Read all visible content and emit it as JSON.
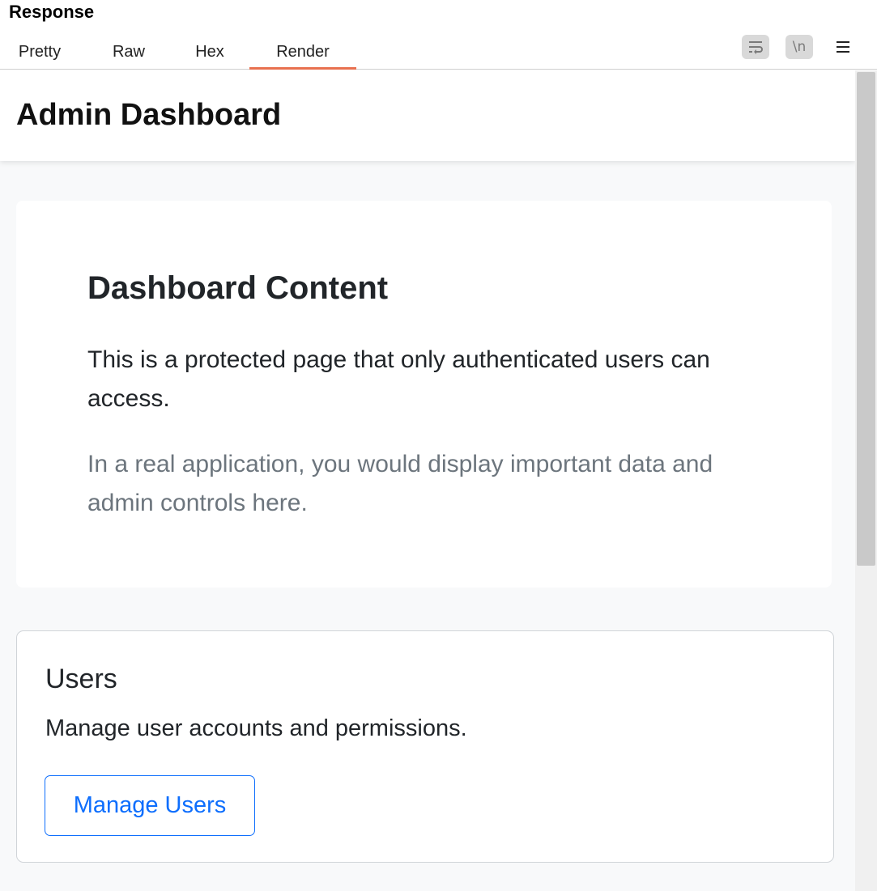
{
  "panel": {
    "title": "Response",
    "tabs": [
      {
        "label": "Pretty"
      },
      {
        "label": "Raw"
      },
      {
        "label": "Hex"
      },
      {
        "label": "Render"
      }
    ],
    "active_tab": "Render",
    "toolbar": {
      "wrap_icon": "word-wrap-icon",
      "newline_label": "\\n",
      "menu_icon": "hamburger-menu-icon"
    },
    "accent_color": "#e8704f"
  },
  "page": {
    "header_title": "Admin Dashboard",
    "content": {
      "heading": "Dashboard Content",
      "paragraph1": "This is a protected page that only authenticated users can access.",
      "paragraph2": "In a real application, you would display important data and admin controls here."
    },
    "users_card": {
      "title": "Users",
      "description": "Manage user accounts and permissions.",
      "button_label": "Manage Users",
      "button_color": "#0d6efd"
    }
  }
}
